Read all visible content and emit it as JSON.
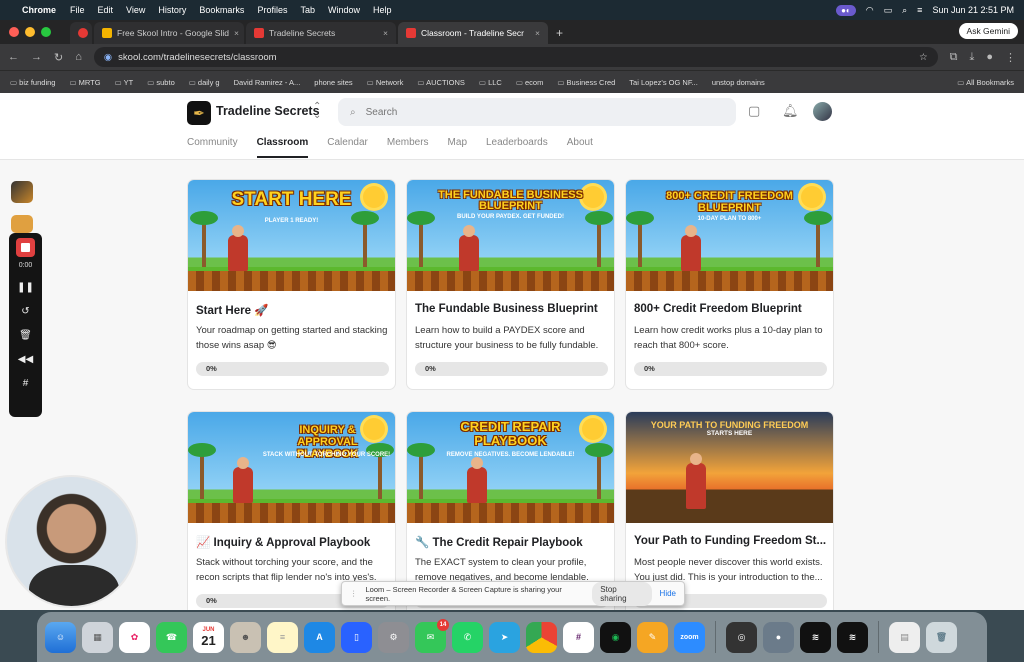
{
  "menubar": {
    "app_name": "Chrome",
    "items": [
      "File",
      "Edit",
      "View",
      "History",
      "Bookmarks",
      "Profiles",
      "Tab",
      "Window",
      "Help"
    ],
    "datetime": "Sun Jun 21  2:51 PM"
  },
  "browser": {
    "tabs": [
      {
        "label": "Free Skool Intro - Google Slid",
        "color": "#f4b400"
      },
      {
        "label": "Tradeline Secrets",
        "color": "#e53935"
      },
      {
        "label": "Classroom - Tradeline Secr",
        "color": "#e53935"
      }
    ],
    "ask_gemini": "Ask Gemini",
    "url": "skool.com/tradelinesecrets/classroom",
    "bookmarks": [
      "biz funding",
      "MRTG",
      "YT",
      "subto",
      "daily g",
      "David Ramirez - A...",
      "phone sites",
      "Network",
      "AUCTIONS",
      "LLC",
      "ecom",
      "Business Cred",
      "Tai Lopez's OG NF...",
      "unstop domains"
    ],
    "all_bookmarks": "All Bookmarks"
  },
  "header": {
    "group_name": "Tradeline Secrets",
    "search_placeholder": "Search",
    "nav": [
      "Community",
      "Classroom",
      "Calendar",
      "Members",
      "Map",
      "Leaderboards",
      "About"
    ],
    "active_nav": "Classroom"
  },
  "courses": [
    {
      "art_title": "START HERE",
      "art_sub": "PLAYER 1 READY!",
      "title": "Start Here 🚀",
      "desc": "Your roadmap on getting started and stacking those wins asap 😎",
      "progress_label": "0%",
      "progress": 0
    },
    {
      "art_title": "THE FUNDABLE BUSINESS BLUEPRINT",
      "art_sub": "BUILD YOUR PAYDEX. GET FUNDED!",
      "title": "The Fundable Business Blueprint",
      "desc": "Learn how to build a PAYDEX score and structure your business to be fully fundable.",
      "progress_label": "0%",
      "progress": 0
    },
    {
      "art_title": "800+ CREDIT FREEDOM BLUEPRINT",
      "art_sub": "10-DAY PLAN TO 800+",
      "title": "800+ Credit Freedom Blueprint",
      "desc": "Learn how credit works plus a 10-day plan to reach that 800+ score.",
      "progress_label": "0%",
      "progress": 0
    },
    {
      "art_title": "INQUIRY & APPROVAL PLAYBOOK",
      "art_sub": "STACK WITHOUT TORCHING YOUR SCORE!",
      "title": "📈 Inquiry & Approval Playbook",
      "desc": "Stack without torching your score, and the recon scripts that flip lender no's into yes's.",
      "progress_label": "0%",
      "progress": 0
    },
    {
      "art_title": "CREDIT REPAIR PLAYBOOK",
      "art_sub": "REMOVE NEGATIVES. BECOME LENDABLE!",
      "title": "🔧 The Credit Repair Playbook",
      "desc": "The EXACT system to clean your profile, remove negatives, and become lendable.",
      "progress_label": "0%",
      "progress": 0
    },
    {
      "art_title": "YOUR PATH TO FUNDING FREEDOM",
      "art_sub": "STARTS HERE",
      "title": "Your Path to Funding Freedom St...",
      "desc": "Most people never discover this world exists. You just did. This is your introduction to the...",
      "progress_label": "0%",
      "progress": 0
    }
  ],
  "loom": {
    "timer": "0:00",
    "banner_text": "Loom – Screen Recorder & Screen Capture is sharing your screen.",
    "stop_label": "Stop sharing",
    "hide_label": "Hide"
  },
  "dock": {
    "calendar_day": "21",
    "calendar_month": "JUN",
    "messages_badge": "14",
    "zoom_label": "zoom"
  }
}
